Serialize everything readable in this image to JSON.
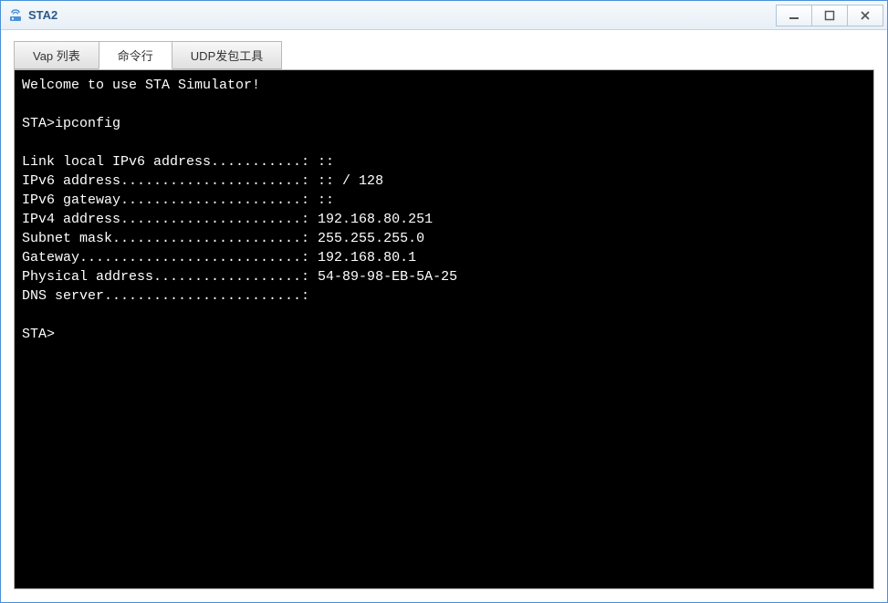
{
  "window": {
    "title": "STA2"
  },
  "tabs": {
    "vap_list": "Vap 列表",
    "cmd_line": "命令行",
    "udp_tool": "UDP发包工具"
  },
  "terminal": {
    "welcome": "Welcome to use STA Simulator!",
    "prompt1": "STA>ipconfig",
    "link_local_ipv6": "Link local IPv6 address...........: ::",
    "ipv6_address": "IPv6 address......................: :: / 128",
    "ipv6_gateway": "IPv6 gateway......................: ::",
    "ipv4_address": "IPv4 address......................: 192.168.80.251",
    "subnet_mask": "Subnet mask.......................: 255.255.255.0",
    "gateway": "Gateway...........................: 192.168.80.1",
    "physical_addr": "Physical address..................: 54-89-98-EB-5A-25",
    "dns_server": "DNS server........................:",
    "prompt2": "STA>"
  }
}
